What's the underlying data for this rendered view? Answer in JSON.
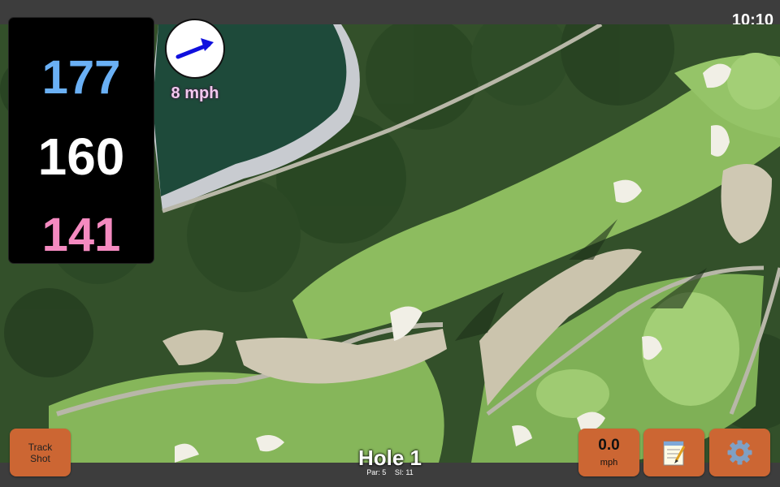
{
  "status": {
    "time": "10:10"
  },
  "distances": {
    "back": "177",
    "middle": "160",
    "front": "141"
  },
  "wind": {
    "speed_label": "8 mph",
    "direction": "arrow pointing up-right"
  },
  "hole": {
    "title": "Hole 1",
    "par_label": "Par: 5",
    "si_label": "SI: 11"
  },
  "buttons": {
    "track_shot": "Track\nShot",
    "wind_value": "0.0",
    "wind_unit": "mph",
    "notes_icon": "notepad-icon",
    "settings_icon": "gear-icon"
  },
  "colors": {
    "back_distance": "#6ab0f5",
    "middle_distance": "#ffffff",
    "front_distance": "#f48ac0",
    "button": "#cc6633",
    "wind_label": "#f2c9ef"
  }
}
